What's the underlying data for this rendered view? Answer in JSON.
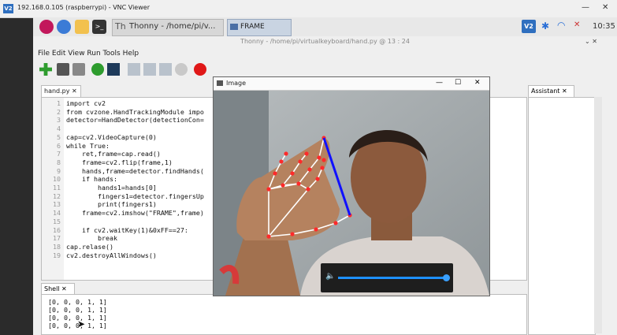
{
  "vnc": {
    "title": "192.168.0.105 (raspberrypi) - VNC Viewer",
    "logo": "V2",
    "minimize": "—",
    "close": "✕"
  },
  "taskbar": {
    "thonny_label": "Thonny - /home/pi/v...",
    "frame_label": "FRAME",
    "tray_v2": "V2",
    "clock": "10:35"
  },
  "thonny": {
    "title": "Thonny - /home/pi/virtualkeyboard/hand.py @ 13 : 24",
    "menu": "File  Edit  View  Run  Tools  Help",
    "window_controls": "⌄  ✕"
  },
  "editor": {
    "tab_label": "hand.py ✕",
    "lines": [
      {
        "n": "1",
        "t": "import cv2"
      },
      {
        "n": "2",
        "t": "from cvzone.HandTrackingModule impo"
      },
      {
        "n": "3",
        "t": "detector=HandDetector(detectionCon="
      },
      {
        "n": "4",
        "t": ""
      },
      {
        "n": "5",
        "t": "cap=cv2.VideoCapture(0)"
      },
      {
        "n": "6",
        "t": "while True:"
      },
      {
        "n": "7",
        "t": "    ret,frame=cap.read()"
      },
      {
        "n": "8",
        "t": "    frame=cv2.flip(frame,1)"
      },
      {
        "n": "9",
        "t": "    hands,frame=detector.findHands("
      },
      {
        "n": "10",
        "t": "    if hands:"
      },
      {
        "n": "11",
        "t": "        hands1=hands[0]"
      },
      {
        "n": "12",
        "t": "        fingers1=detector.fingersUp"
      },
      {
        "n": "13",
        "t": "        print(fingers1)"
      },
      {
        "n": "14",
        "t": "    frame=cv2.imshow(\"FRAME\",frame)"
      },
      {
        "n": "15",
        "t": ""
      },
      {
        "n": "16",
        "t": "    if cv2.waitKey(1)&0xFF==27:"
      },
      {
        "n": "17",
        "t": "        break"
      },
      {
        "n": "18",
        "t": "cap.relase()"
      },
      {
        "n": "19",
        "t": "cv2.destroyAllWindows()"
      }
    ]
  },
  "shell": {
    "tab_label": "Shell ✕",
    "lines": [
      "[0, 0, 0, 1, 1]",
      "[0, 0, 0, 1, 1]",
      "[0, 0, 0, 1, 1]",
      "[0, 0, 0, 1, 1]"
    ]
  },
  "assistant": {
    "tab_label": "Assistant ✕"
  },
  "image_window": {
    "title": "Image",
    "minimize": "—",
    "maximize": "☐",
    "close": "✕",
    "volume_level": 0.98
  },
  "colors": {
    "accent": "#2f6fbf",
    "bar": "#1e90ff",
    "landmark": "#ff2a2a",
    "link_line": "#1010ff"
  }
}
